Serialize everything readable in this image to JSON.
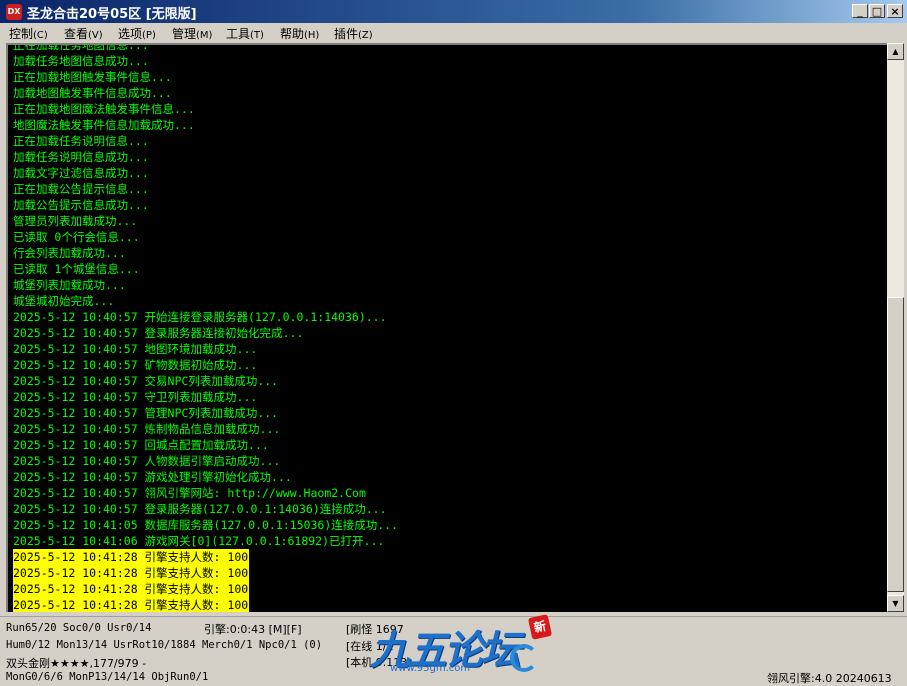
{
  "window": {
    "icon_text": "DX",
    "title": "圣龙合击20号05区 [无限版]",
    "buttons": {
      "minimize": "_",
      "maximize": "□",
      "close": "×"
    }
  },
  "menu": [
    {
      "label": "控制",
      "accel": "(C)"
    },
    {
      "label": "查看",
      "accel": "(V)"
    },
    {
      "label": "选项",
      "accel": "(P)"
    },
    {
      "label": "管理",
      "accel": "(M)"
    },
    {
      "label": "工具",
      "accel": "(T)"
    },
    {
      "label": "帮助",
      "accel": "(H)"
    },
    {
      "label": "插件",
      "accel": "(Z)"
    }
  ],
  "log": [
    {
      "text": "正在加载任务地图信息...",
      "highlight": false
    },
    {
      "text": "加载任务地图信息成功...",
      "highlight": false
    },
    {
      "text": "正在加载地图触发事件信息...",
      "highlight": false
    },
    {
      "text": "加载地图触发事件信息成功...",
      "highlight": false
    },
    {
      "text": "正在加载地图魔法触发事件信息...",
      "highlight": false
    },
    {
      "text": "地图魔法触发事件信息加载成功...",
      "highlight": false
    },
    {
      "text": "正在加载任务说明信息...",
      "highlight": false
    },
    {
      "text": "加载任务说明信息成功...",
      "highlight": false
    },
    {
      "text": "加载文字过滤信息成功...",
      "highlight": false
    },
    {
      "text": "正在加载公告提示信息...",
      "highlight": false
    },
    {
      "text": "加载公告提示信息成功...",
      "highlight": false
    },
    {
      "text": "管理员列表加载成功...",
      "highlight": false
    },
    {
      "text": "已读取 0个行会信息...",
      "highlight": false
    },
    {
      "text": "行会列表加载成功...",
      "highlight": false
    },
    {
      "text": "已读取 1个城堡信息...",
      "highlight": false
    },
    {
      "text": "城堡列表加载成功...",
      "highlight": false
    },
    {
      "text": "城堡城初始完成...",
      "highlight": false
    },
    {
      "text": "2025-5-12 10:40:57 开始连接登录服务器(127.0.0.1:14036)...",
      "highlight": false
    },
    {
      "text": "2025-5-12 10:40:57 登录服务器连接初始化完成...",
      "highlight": false
    },
    {
      "text": "2025-5-12 10:40:57 地图环境加载成功...",
      "highlight": false
    },
    {
      "text": "2025-5-12 10:40:57 矿物数据初始成功...",
      "highlight": false
    },
    {
      "text": "2025-5-12 10:40:57 交易NPC列表加载成功...",
      "highlight": false
    },
    {
      "text": "2025-5-12 10:40:57 守卫列表加载成功...",
      "highlight": false
    },
    {
      "text": "2025-5-12 10:40:57 管理NPC列表加载成功...",
      "highlight": false
    },
    {
      "text": "2025-5-12 10:40:57 炼制物品信息加载成功...",
      "highlight": false
    },
    {
      "text": "2025-5-12 10:40:57 回城点配置加载成功...",
      "highlight": false
    },
    {
      "text": "2025-5-12 10:40:57 人物数据引擎启动成功...",
      "highlight": false
    },
    {
      "text": "2025-5-12 10:40:57 游戏处理引擎初始化成功...",
      "highlight": false
    },
    {
      "text": "2025-5-12 10:40:57 翎风引擎网站: http://www.Haom2.Com",
      "highlight": false
    },
    {
      "text": "2025-5-12 10:40:57 登录服务器(127.0.0.1:14036)连接成功...",
      "highlight": false
    },
    {
      "text": "2025-5-12 10:41:05 数据库服务器(127.0.0.1:15036)连接成功...",
      "highlight": false
    },
    {
      "text": "2025-5-12 10:41:06 游戏网关[0](127.0.0.1:61892)已打开...",
      "highlight": false
    },
    {
      "text": "2025-5-12 10:41:28 引擎支持人数: 100",
      "highlight": true
    },
    {
      "text": "2025-5-12 10:41:28 引擎支持人数: 100",
      "highlight": true
    },
    {
      "text": "2025-5-12 10:41:28 引擎支持人数: 100",
      "highlight": true
    },
    {
      "text": "2025-5-12 10:41:28 引擎支持人数: 100",
      "highlight": true
    }
  ],
  "scrollbar": {
    "up": "▲",
    "down": "▼"
  },
  "status": {
    "run": "Run65/20 Soc0/0 Usr0/14",
    "engine": "引擎:0:0:43 [M][F]",
    "refresh": "[刷怪 1697",
    "hum": "Hum0/12 Mon13/14 UsrRot10/1884 Merch0/1 Npc0/1 (0)",
    "online": "[在线 1/1",
    "player": "双头金刚★★★★,177/979 -",
    "version_short": "[本机 9.113",
    "mon": "MonG0/6/6 MonP13/14/14 ObjRun0/1",
    "version": "翎风引擎:4.0 20240613"
  },
  "watermark": {
    "main": "九五论坛",
    "sub": "www.95gm.com",
    "seal": "新"
  }
}
